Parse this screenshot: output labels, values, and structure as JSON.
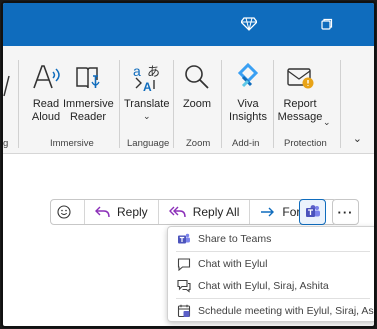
{
  "ribbon": {
    "buttons": {
      "read_aloud": "Read Aloud",
      "immersive_reader": "Immersive Reader",
      "translate": "Translate",
      "zoom": "Zoom",
      "viva_insights": "Viva Insights",
      "report_message": "Report Message"
    },
    "groups": {
      "immersive": "Immersive",
      "language": "Language",
      "zoom": "Zoom",
      "addin": "Add-in",
      "protection": "Protection",
      "partial_left": "g"
    }
  },
  "action_bar": {
    "reply": "Reply",
    "reply_all": "Reply All",
    "forward": "Forward"
  },
  "teams_menu": {
    "items": [
      "Share to Teams",
      "Chat with Eylul",
      "Chat with Eylul, Siraj, Ashita",
      "Schedule meeting with Eylul, Siraj, Ashita..."
    ]
  },
  "colors": {
    "titlebar": "#0f6cbd",
    "accent_purple": "#8b2fb8",
    "accent_blue": "#0f6cbd",
    "teams_purple": "#5b5fc7"
  }
}
